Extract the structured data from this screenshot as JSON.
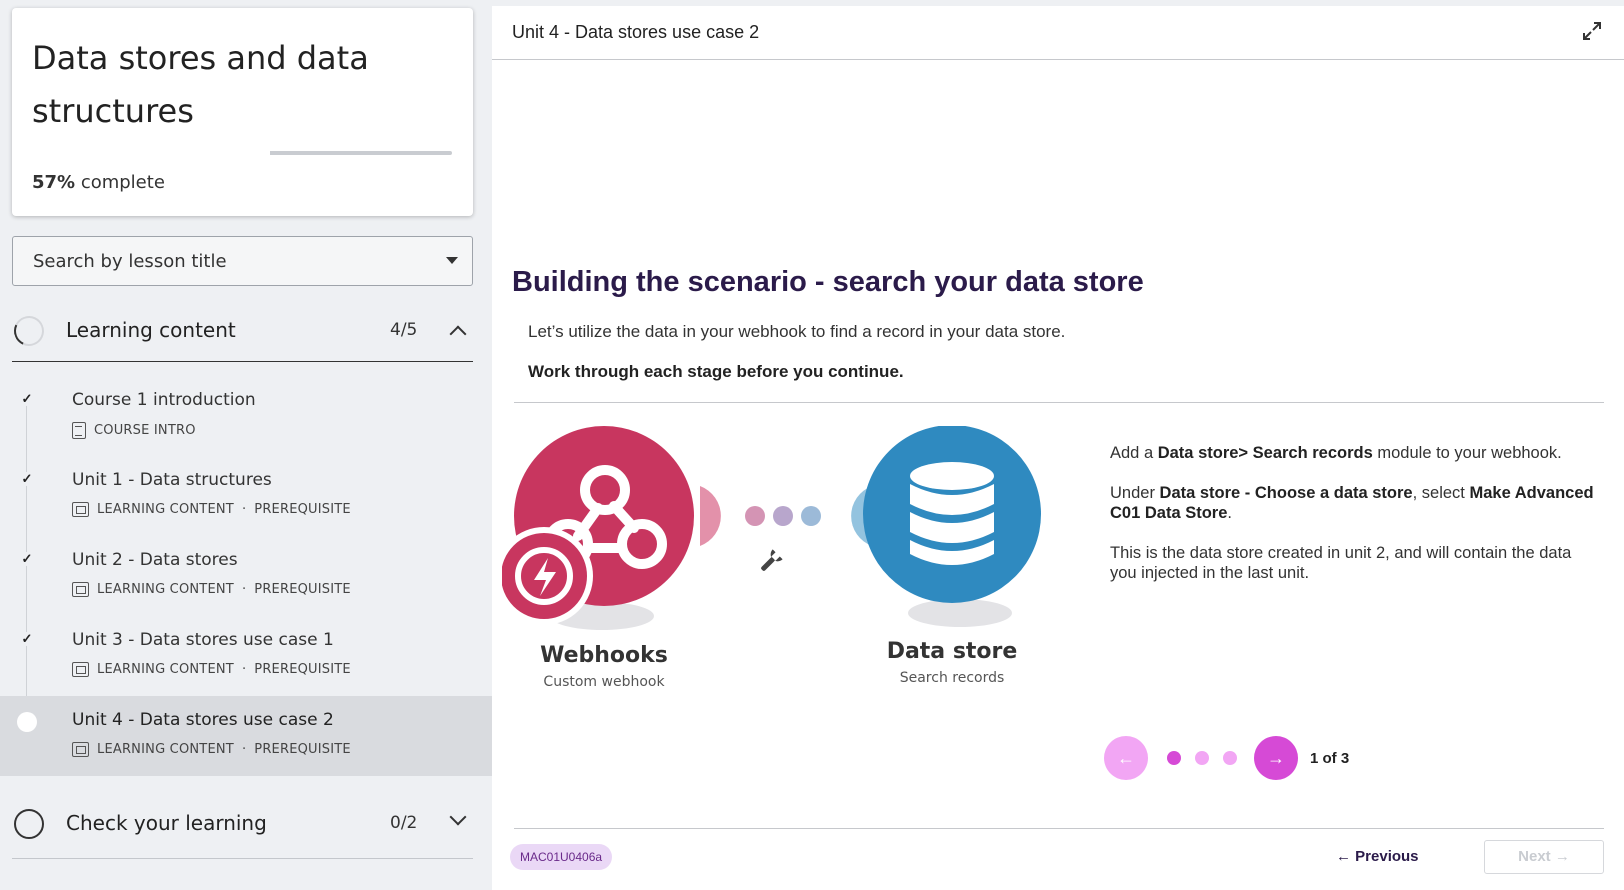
{
  "course": {
    "title": "Data stores and data structures",
    "progress_percent": 57,
    "progress_value": "57%",
    "progress_suffix": " complete"
  },
  "search": {
    "placeholder": "Search by lesson title"
  },
  "sections": [
    {
      "title": "Learning content",
      "count": "4/5",
      "expanded": true
    },
    {
      "title": "Check your learning",
      "count": "0/2",
      "expanded": false
    }
  ],
  "lessons": [
    {
      "title": "Course 1 introduction",
      "type": "COURSE INTRO",
      "tag": "",
      "done": true,
      "icon": "document-icon"
    },
    {
      "title": "Unit 1 - Data structures",
      "type": "LEARNING CONTENT",
      "tag": "PREREQUISITE",
      "done": true,
      "icon": "slides-icon"
    },
    {
      "title": "Unit 2 - Data stores",
      "type": "LEARNING CONTENT",
      "tag": "PREREQUISITE",
      "done": true,
      "icon": "slides-icon"
    },
    {
      "title": "Unit 3 - Data stores use case 1",
      "type": "LEARNING CONTENT",
      "tag": "PREREQUISITE",
      "done": true,
      "icon": "slides-icon"
    },
    {
      "title": "Unit 4 - Data stores use case 2",
      "type": "LEARNING CONTENT",
      "tag": "PREREQUISITE",
      "done": false,
      "active": true,
      "icon": "slides-icon"
    }
  ],
  "meta_separator": "·",
  "main": {
    "unit_title": "Unit 4 - Data stores use case 2",
    "heading": "Building the scenario - search your data store",
    "intro": "Let’s utilize the data in your webhook to find a record in your data store.",
    "instruction": "Work through each stage before you continue."
  },
  "diagram": {
    "module1": {
      "title": "Webhooks",
      "subtitle": "Custom webhook",
      "color": "#c8365f",
      "icon": "webhook-icon"
    },
    "module2": {
      "title": "Data store",
      "subtitle": "Search records",
      "color": "#2f8ac0",
      "icon": "database-icon"
    },
    "connector_icon": "wrench-icon",
    "trigger_icon": "lightning-icon"
  },
  "description": [
    [
      "Add a ",
      {
        "b": "Data store> Search records"
      },
      " module to your webhook."
    ],
    [
      "Under ",
      {
        "b": "Data store - Choose a data store"
      },
      ", select ",
      {
        "b": "Make Advanced C01 Data Store"
      },
      "."
    ],
    [
      "This is the data store created in unit 2, and will contain the data you injected in the last unit."
    ]
  ],
  "carousel": {
    "counter": "1 of 3",
    "current": 1,
    "total": 3,
    "prev_icon": "arrow-left-icon",
    "next_icon": "arrow-right-icon"
  },
  "footer": {
    "code": "MAC01U0406a",
    "previous_label": "← Previous",
    "next_label": "Next →"
  },
  "colors": {
    "accent": "#d64ad6",
    "accent_light": "#f2a6f4",
    "heading": "#2b1b4a"
  }
}
